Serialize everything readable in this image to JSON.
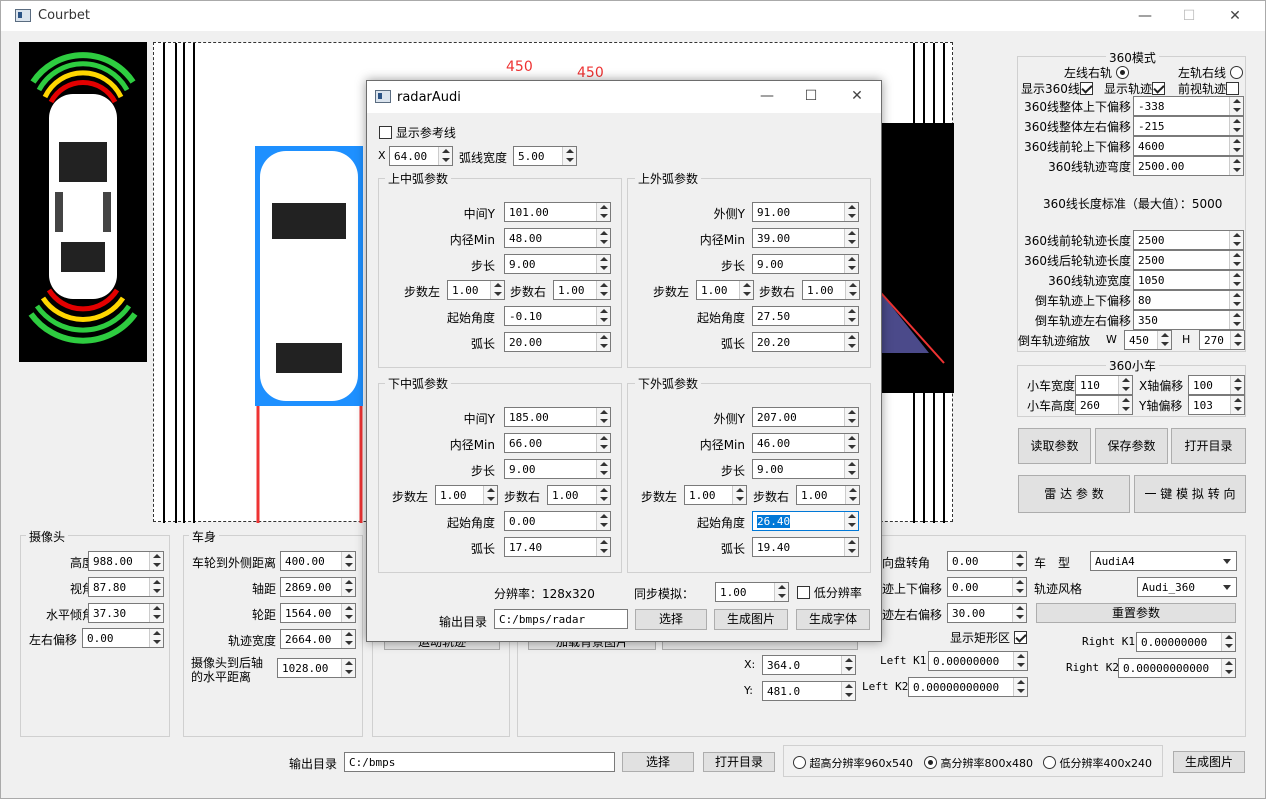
{
  "window": {
    "title": "Courbet",
    "min": "—",
    "max": "☐",
    "close": "✕"
  },
  "canvas": {
    "label_450_a": "450",
    "label_450_b": "450"
  },
  "mode360": {
    "title": "360模式",
    "radio_left": "左线右轨",
    "radio_right": "左轨右线",
    "show360": "显示360线",
    "show_track": "显示轨迹",
    "front_view": "前视轨迹",
    "rows": [
      {
        "label": "360线整体上下偏移",
        "value": "-338"
      },
      {
        "label": "360线整体左右偏移",
        "value": "-215"
      },
      {
        "label": "360线前轮上下偏移",
        "value": "4600"
      },
      {
        "label": "360线轨迹弯度",
        "value": "2500.00"
      }
    ],
    "std_label": "360线长度标准（最大值）：5000",
    "rows2": [
      {
        "label": "360线前轮轨迹长度",
        "value": "2500"
      },
      {
        "label": "360线后轮轨迹长度",
        "value": "2500"
      },
      {
        "label": "360线轨迹宽度",
        "value": "1050"
      },
      {
        "label": "倒车轨迹上下偏移",
        "value": "80"
      },
      {
        "label": "倒车轨迹左右偏移",
        "value": "350"
      }
    ],
    "scale_label": "倒车轨迹缩放",
    "w_label": "W",
    "w_value": "450",
    "h_label": "H",
    "h_value": "270"
  },
  "car360": {
    "title": "360小车",
    "width_label": "小车宽度",
    "width_value": "110",
    "height_label": "小车高度",
    "height_value": "260",
    "x_label": "X轴偏移",
    "x_value": "100",
    "y_label": "Y轴偏移",
    "y_value": "103"
  },
  "buttons": {
    "read": "读取参数",
    "save": "保存参数",
    "open": "打开目录",
    "radar": "雷 达 参 数",
    "sim": "一 键 模 拟 转 向",
    "reset": "重置参数",
    "choose": "选择",
    "open_dir": "打开目录",
    "gen": "生成图片"
  },
  "camera": {
    "title": "摄像头",
    "rows": [
      {
        "label": "高度",
        "value": "988.00"
      },
      {
        "label": "视角",
        "value": "87.80"
      },
      {
        "label": "水平倾角",
        "value": "37.30"
      },
      {
        "label": "左右偏移",
        "value": "0.00"
      }
    ]
  },
  "body": {
    "title": "车身",
    "rows": [
      {
        "label": "车轮到外侧距离",
        "value": "400.00"
      },
      {
        "label": "轴距",
        "value": "2869.00"
      },
      {
        "label": "轮距",
        "value": "1564.00"
      },
      {
        "label": "轨迹宽度",
        "value": "2664.00"
      }
    ],
    "rear_l1": "摄像头到后轴",
    "rear_l2": "的水平距离",
    "rear_value": "1028.00"
  },
  "mid": {
    "btn_a": "运动轨迹",
    "btn_b": "加载背景图片",
    "x_label": "X:",
    "x_value": "364.0",
    "y_label": "Y:",
    "y_value": "481.0"
  },
  "right": {
    "steer_label": "向盘转角",
    "steer_value": "0.00",
    "model_label": "车　型",
    "model_value": "AudiA4",
    "ud_label": "迹上下偏移",
    "ud_value": "0.00",
    "style_label": "轨迹风格",
    "style_value": "Audi_360",
    "lr_label": "迹左右偏移",
    "lr_value": "30.00",
    "rect_label": "显示矩形区",
    "rk1_label": "Right K1",
    "rk1_value": "0.00000000",
    "lk1_label": "Left K1",
    "lk1_value": "0.00000000",
    "rk2_label": "Right K2",
    "rk2_value": "0.00000000000",
    "lk2_label": "Left K2",
    "lk2_value": "0.00000000000"
  },
  "output": {
    "label": "输出目录",
    "value": "C:/bmps",
    "res1": "超高分辨率960x540",
    "res2": "高分辨率800x480",
    "res3": "低分辨率400x240"
  },
  "dialog": {
    "title": "radarAudi",
    "show_ref": "显示参考线",
    "x_label": "X",
    "x_value": "64.00",
    "arcw_label": "弧线宽度",
    "arcw_value": "5.00",
    "upper_mid": {
      "title": "上中弧参数",
      "rows": [
        {
          "label": "中间Y",
          "value": "101.00"
        },
        {
          "label": "内径Min",
          "value": "48.00"
        },
        {
          "label": "步长",
          "value": "9.00"
        }
      ],
      "stepl": "步数左",
      "stepl_v": "1.00",
      "stepr": "步数右",
      "stepr_v": "1.00",
      "angle_label": "起始角度",
      "angle": "-0.10",
      "arc_label": "弧长",
      "arc": "20.00"
    },
    "upper_out": {
      "title": "上外弧参数",
      "rows": [
        {
          "label": "外侧Y",
          "value": "91.00"
        },
        {
          "label": "内径Min",
          "value": "39.00"
        },
        {
          "label": "步长",
          "value": "9.00"
        }
      ],
      "stepl": "步数左",
      "stepl_v": "1.00",
      "stepr": "步数右",
      "stepr_v": "1.00",
      "angle_label": "起始角度",
      "angle": "27.50",
      "arc_label": "弧长",
      "arc": "20.20"
    },
    "lower_mid": {
      "title": "下中弧参数",
      "rows": [
        {
          "label": "中间Y",
          "value": "185.00"
        },
        {
          "label": "内径Min",
          "value": "66.00"
        },
        {
          "label": "步长",
          "value": "9.00"
        }
      ],
      "stepl": "步数左",
      "stepl_v": "1.00",
      "stepr": "步数右",
      "stepr_v": "1.00",
      "angle_label": "起始角度",
      "angle": "0.00",
      "arc_label": "弧长",
      "arc": "17.40"
    },
    "lower_out": {
      "title": "下外弧参数",
      "rows": [
        {
          "label": "外侧Y",
          "value": "207.00"
        },
        {
          "label": "内径Min",
          "value": "46.00"
        },
        {
          "label": "步长",
          "value": "9.00"
        }
      ],
      "stepl": "步数左",
      "stepl_v": "1.00",
      "stepr": "步数右",
      "stepr_v": "1.00",
      "angle_label": "起始角度",
      "angle": "26.40",
      "arc_label": "弧长",
      "arc": "19.40"
    },
    "res_label": "分辨率：128x320",
    "sync_label": "同步模拟：",
    "sync_value": "1.00",
    "lowres": "低分辨率",
    "out_label": "输出目录",
    "out_value": "C:/bmps/radar",
    "choose": "选择",
    "gen_img": "生成图片",
    "gen_font": "生成字体"
  }
}
